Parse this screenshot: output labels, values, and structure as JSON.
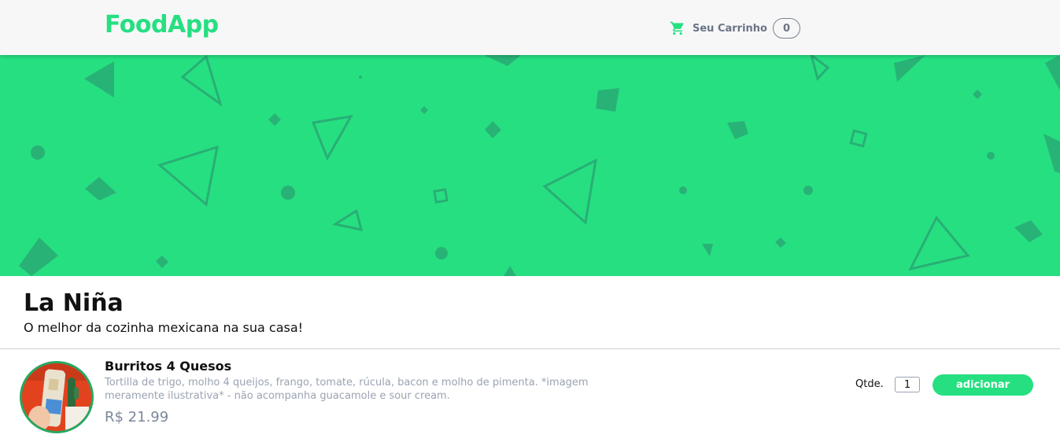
{
  "header": {
    "brand": "FoodApp",
    "cart_label": "Seu Carrinho",
    "cart_count": "0",
    "cart_icon": "shopping-cart-icon"
  },
  "colors": {
    "accent": "#26df81",
    "muted_text": "#9aa3b2",
    "price_text": "#7c879a"
  },
  "restaurant": {
    "name": "La Niña",
    "subtitle": "O melhor da cozinha mexicana na sua casa!"
  },
  "products": [
    {
      "name": "Burritos 4 Quesos",
      "description": "Tortilla de trigo, molho 4 queijos, frango, tomate, rúcula, bacon e molho de pimenta. *imagem meramente ilustrativa* - não acompanha guacamole e sour cream.",
      "price": "R$ 21.99",
      "qty_label": "Qtde.",
      "qty_value": "1",
      "add_label": "adicionar"
    }
  ]
}
